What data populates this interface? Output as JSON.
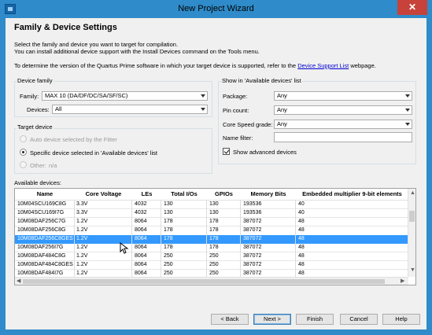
{
  "window": {
    "title": "New Project Wizard",
    "close_label": "✕"
  },
  "page": {
    "title": "Family & Device Settings",
    "desc1": "Select the family and device you want to target for compilation.",
    "desc2": "You can install additional device support with the Install Devices command on the Tools menu.",
    "desc3_prefix": "To determine the version of the Quartus Prime software in which your target device is supported, refer to the ",
    "desc3_link": "Device Support List",
    "desc3_suffix": " webpage."
  },
  "device_family": {
    "group_label": "Device family",
    "family_label": "Family:",
    "family_value": "MAX 10 (DA/DF/DC/SA/SF/SC)",
    "devices_label": "Devices:",
    "devices_value": "All"
  },
  "target_device": {
    "group_label": "Target device",
    "option_auto": "Auto device selected by the Fitter",
    "option_specific": "Specific device selected in 'Available devices' list",
    "option_other": "Other:",
    "other_value": "n/a"
  },
  "show_filters": {
    "group_label": "Show in 'Available devices' list",
    "package_label": "Package:",
    "package_value": "Any",
    "pin_count_label": "Pin count:",
    "pin_count_value": "Any",
    "speed_label": "Core Speed grade:",
    "speed_value": "Any",
    "name_filter_label": "Name filter:",
    "name_filter_value": "",
    "show_advanced_label": "Show advanced devices",
    "show_advanced_checked": true
  },
  "available_devices": {
    "label": "Available devices:",
    "columns": [
      "Name",
      "Core Voltage",
      "LEs",
      "Total I/Os",
      "GPIOs",
      "Memory Bits",
      "Embedded multiplier 9-bit elements"
    ],
    "rows": [
      [
        "10M04SCU169C8G",
        "3.3V",
        "4032",
        "130",
        "130",
        "193536",
        "40"
      ],
      [
        "10M04SCU169I7G",
        "3.3V",
        "4032",
        "130",
        "130",
        "193536",
        "40"
      ],
      [
        "10M08DAF256C7G",
        "1.2V",
        "8064",
        "178",
        "178",
        "387072",
        "48"
      ],
      [
        "10M08DAF256C8G",
        "1.2V",
        "8064",
        "178",
        "178",
        "387072",
        "48"
      ],
      [
        "10M08DAF256C8GES",
        "1.2V",
        "8064",
        "178",
        "178",
        "387072",
        "48"
      ],
      [
        "10M08DAF256I7G",
        "1.2V",
        "8064",
        "178",
        "178",
        "387072",
        "48"
      ],
      [
        "10M08DAF484C8G",
        "1.2V",
        "8064",
        "250",
        "250",
        "387072",
        "48"
      ],
      [
        "10M08DAF484C8GES",
        "1.2V",
        "8064",
        "250",
        "250",
        "387072",
        "48"
      ],
      [
        "10M08DAF484I7G",
        "1.2V",
        "8064",
        "250",
        "250",
        "387072",
        "48"
      ]
    ],
    "selected_row": 4
  },
  "buttons": {
    "back": "< Back",
    "next": "Next >",
    "finish": "Finish",
    "cancel": "Cancel",
    "help": "Help"
  }
}
